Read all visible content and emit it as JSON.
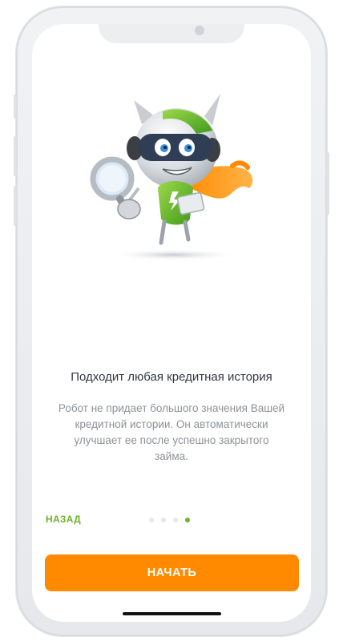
{
  "onboarding": {
    "title": "Подходит любая кредитная история",
    "description": "Робот не придает большого значения Вашей кредитной истории. Он автоматически улучшает ее после успешно закрытого займа.",
    "back_label": "НАЗАД",
    "start_label": "НАЧАТЬ",
    "pagination": {
      "total": 4,
      "active_index": 3
    }
  },
  "colors": {
    "accent_orange": "#ff8a00",
    "accent_green": "#6fb22b",
    "title_text": "#333840",
    "body_text": "#8e9297"
  },
  "illustration": {
    "icon": "robot-mascot-with-magnifier"
  }
}
